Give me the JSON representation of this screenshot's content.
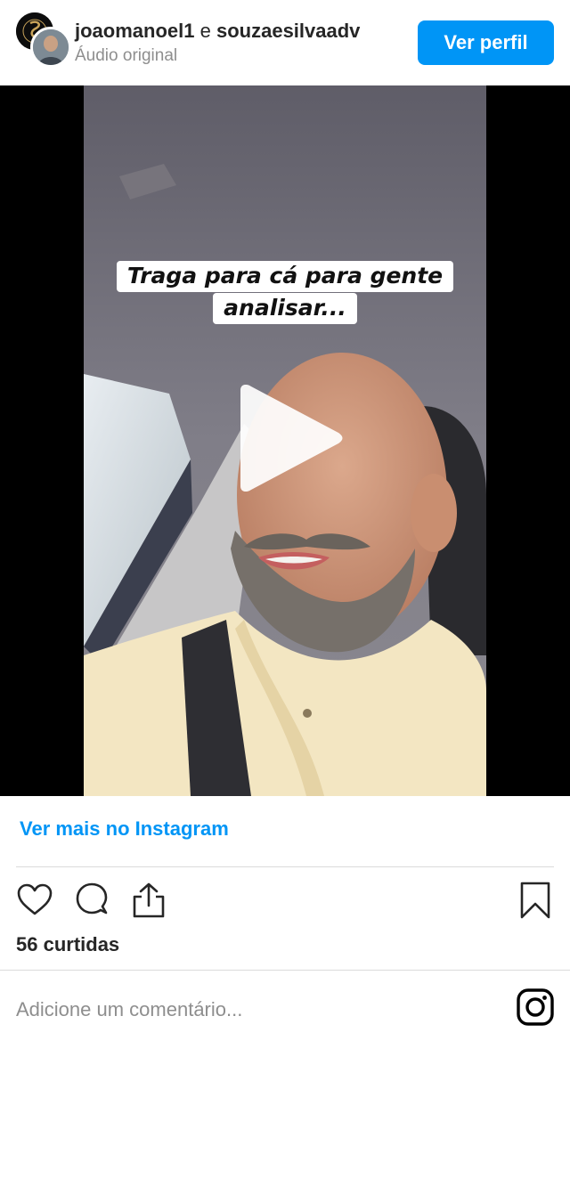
{
  "header": {
    "author_primary": "joaomanoel1",
    "connector": "e",
    "author_secondary": "souzaesilvaadv",
    "audio_label": "Áudio original",
    "view_profile_label": "Ver perfil"
  },
  "video": {
    "caption": "Traga para cá para gente analisar...",
    "state": "paused"
  },
  "footer": {
    "see_more_label": "Ver mais no Instagram",
    "likes_text": "56 curtidas",
    "comment_placeholder": "Adicione um comentário..."
  },
  "icons": {
    "like": "heart-icon",
    "comment": "comment-icon",
    "share": "share-icon",
    "save": "bookmark-icon",
    "brand": "instagram-logo-icon",
    "play": "play-icon"
  },
  "colors": {
    "accent": "#0095f6",
    "text": "#262626",
    "muted": "#8e8e8e",
    "divider": "#dbdbdb"
  }
}
